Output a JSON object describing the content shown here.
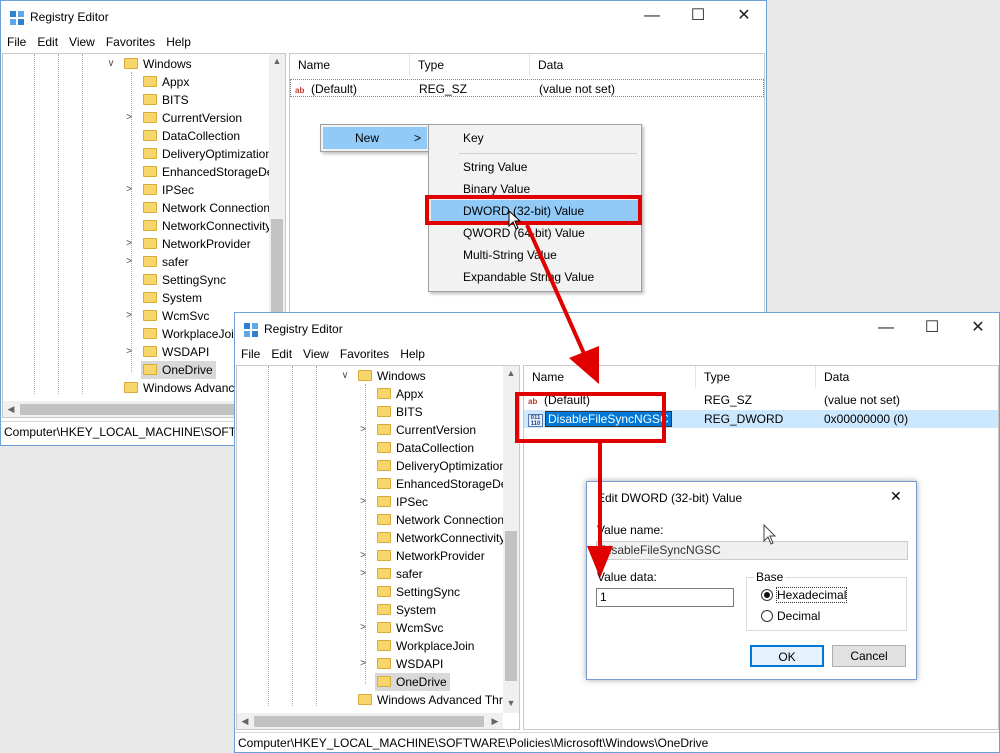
{
  "title": "Registry Editor",
  "menu": [
    "File",
    "Edit",
    "View",
    "Favorites",
    "Help"
  ],
  "window_controls": {
    "minimize": "—",
    "maximize": "☐",
    "close": "✕"
  },
  "tree": {
    "parent": "Windows",
    "children": [
      "Appx",
      "BITS",
      "CurrentVersion",
      "DataCollection",
      "DeliveryOptimization",
      "EnhancedStorageDevices",
      "IPSec",
      "Network Connections",
      "NetworkConnectivity",
      "NetworkProvider",
      "safer",
      "SettingSync",
      "System",
      "WcmSvc",
      "WorkplaceJoin",
      "WSDAPI",
      "OneDrive"
    ],
    "next_top": "Windows Advanced Threat Protection"
  },
  "list_columns": [
    "Name",
    "Type",
    "Data"
  ],
  "back_rows": [
    {
      "name": "(Default)",
      "type": "REG_SZ",
      "data": "(value not set)"
    }
  ],
  "front_rows": [
    {
      "name": "(Default)",
      "type": "REG_SZ",
      "data": "(value not set)"
    },
    {
      "name": "DisableFileSyncNGSC",
      "type": "REG_DWORD",
      "data": "0x00000000 (0)"
    }
  ],
  "status_back": "Computer\\HKEY_LOCAL_MACHINE\\SOFTWARE\\Policies\\Microsoft\\Windows\\OneDrive",
  "status_front": "Computer\\HKEY_LOCAL_MACHINE\\SOFTWARE\\Policies\\Microsoft\\Windows\\OneDrive",
  "context_menu": {
    "new_label": "New",
    "new_arrow": ">"
  },
  "submenu": {
    "key": "Key",
    "items": [
      "String Value",
      "Binary Value",
      "DWORD (32-bit) Value",
      "QWORD (64-bit) Value",
      "Multi-String Value",
      "Expandable String Value"
    ]
  },
  "dialog": {
    "title": "Edit DWORD (32-bit) Value",
    "value_name_label": "Value name:",
    "value_name": "DisableFileSyncNGSC",
    "value_data_label": "Value data:",
    "value_data": "1",
    "base_label": "Base",
    "hex_label": "Hexadecimal",
    "dec_label": "Decimal",
    "ok": "OK",
    "cancel": "Cancel",
    "close": "✕"
  },
  "colors": {
    "highlight": "#cce8ff",
    "menu_highlight": "#91c9f7",
    "annotation": "#e00000",
    "selection": "#0078d7"
  }
}
